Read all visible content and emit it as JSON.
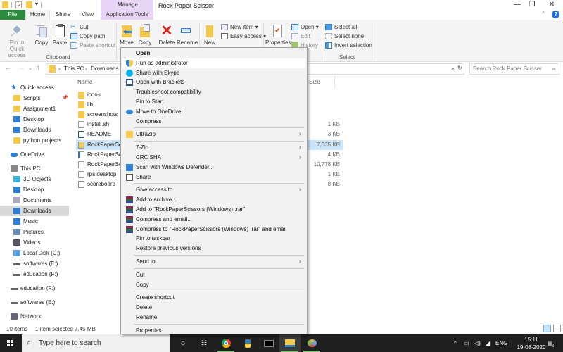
{
  "window": {
    "title": "Rock Paper Scissor",
    "contextual_tab_group": "Manage",
    "controls": {
      "minimize": "—",
      "maximize": "❐",
      "close": "✕"
    }
  },
  "tabs": [
    {
      "label": "File"
    },
    {
      "label": "Home",
      "active": true
    },
    {
      "label": "Share"
    },
    {
      "label": "View"
    },
    {
      "label": "Application Tools"
    }
  ],
  "ribbon": {
    "clipboard": {
      "label": "Clipboard",
      "pin": "Pin to Quick access",
      "pin_line1": "Pin to Quick",
      "pin_line2": "access",
      "copy": "Copy",
      "paste": "Paste",
      "cut": "Cut",
      "copy_path": "Copy path",
      "paste_shortcut": "Paste shortcut"
    },
    "organize": {
      "move": "Move",
      "copy": "Copy",
      "delete": "Delete",
      "rename": "Rename"
    },
    "new": {
      "new_folder": "New",
      "new_item": "New item ▾",
      "easy_access": "Easy access ▾"
    },
    "open": {
      "properties": "Properties",
      "open": "Open ▾",
      "edit": "Edit",
      "history": "History"
    },
    "select": {
      "label": "Select",
      "select_all": "Select all",
      "select_none": "Select none",
      "invert": "Invert selection"
    }
  },
  "address": {
    "breadcrumb": [
      "This PC",
      "Downloads"
    ],
    "separator": "›",
    "search_placeholder": "Search Rock Paper Scissor"
  },
  "navpane": {
    "items": [
      {
        "label": "Quick access",
        "icon": "star-icon",
        "level": 0
      },
      {
        "label": "Scripts",
        "icon": "folder-icon",
        "level": 1,
        "pinned": true
      },
      {
        "label": "Assignment1",
        "icon": "folder-icon",
        "level": 1
      },
      {
        "label": "Desktop",
        "icon": "desktop-icon",
        "level": 1
      },
      {
        "label": "Downloads",
        "icon": "download-icon",
        "level": 1
      },
      {
        "label": "python projects",
        "icon": "folder-icon",
        "level": 1
      },
      {
        "label": "OneDrive",
        "icon": "cloud-icon",
        "level": 0
      },
      {
        "label": "This PC",
        "icon": "pc-icon",
        "level": 0
      },
      {
        "label": "3D Objects",
        "icon": "cube-icon",
        "level": 1
      },
      {
        "label": "Desktop",
        "icon": "desktop-icon",
        "level": 1
      },
      {
        "label": "Documents",
        "icon": "document-icon",
        "level": 1
      },
      {
        "label": "Downloads",
        "icon": "download-icon",
        "level": 1,
        "selected": true
      },
      {
        "label": "Music",
        "icon": "music-icon",
        "level": 1
      },
      {
        "label": "Pictures",
        "icon": "picture-icon",
        "level": 1
      },
      {
        "label": "Videos",
        "icon": "video-icon",
        "level": 1
      },
      {
        "label": "Local Disk (C:)",
        "icon": "disk-icon",
        "level": 1
      },
      {
        "label": "softwares (E:)",
        "icon": "drive-icon",
        "level": 1
      },
      {
        "label": "education (F:)",
        "icon": "drive-icon",
        "level": 1
      },
      {
        "label": "education (F:)",
        "icon": "drive-icon",
        "level": 0
      },
      {
        "label": "softwares (E:)",
        "icon": "drive-icon",
        "level": 0
      },
      {
        "label": "Network",
        "icon": "network-icon",
        "level": 0
      }
    ]
  },
  "filelist": {
    "columns": {
      "name": "Name",
      "size": "Size"
    },
    "files": [
      {
        "name": "icons",
        "type": "folder",
        "size": ""
      },
      {
        "name": "lib",
        "type": "folder",
        "size": ""
      },
      {
        "name": "screenshots",
        "type": "folder",
        "size": ""
      },
      {
        "name": "install.sh",
        "type": "file",
        "size": "1 KB"
      },
      {
        "name": "README",
        "type": "brackets",
        "size": "3 KB"
      },
      {
        "name": "RockPaperScis",
        "type": "exe",
        "size": "7,635 KB",
        "selected": true
      },
      {
        "name": "RockPaperScis",
        "type": "python",
        "size": "4 KB"
      },
      {
        "name": "RockPaperScis",
        "type": "file",
        "size": "10,778 KB"
      },
      {
        "name": "rps.desktop",
        "type": "file",
        "size": "1 KB"
      },
      {
        "name": "scoreboard",
        "type": "text",
        "size": "8 KB"
      }
    ]
  },
  "status": {
    "count": "10 items",
    "selection": "1 item selected  7.45 MB"
  },
  "context_menu": {
    "items": [
      {
        "label": "Open",
        "bold": true
      },
      {
        "label": "Run as administrator",
        "icon": "shield-icon",
        "highlight": true
      },
      {
        "label": "Share with Skype",
        "icon": "skype-icon"
      },
      {
        "label": "Open with Brackets",
        "icon": "brackets-icon"
      },
      {
        "label": "Troubleshoot compatibility"
      },
      {
        "label": "Pin to Start"
      },
      {
        "label": "Move to OneDrive",
        "icon": "onedrive-icon"
      },
      {
        "label": "Compress"
      },
      {
        "sep": true
      },
      {
        "label": "UltraZip",
        "icon": "folder-icon",
        "submenu": true
      },
      {
        "sep": true
      },
      {
        "label": "7-Zip",
        "submenu": true
      },
      {
        "label": "CRC SHA",
        "submenu": true
      },
      {
        "label": "Scan with Windows Defender...",
        "icon": "defender-icon"
      },
      {
        "label": "Share",
        "icon": "share-icon"
      },
      {
        "sep": true
      },
      {
        "label": "Give access to",
        "submenu": true
      },
      {
        "label": "Add to archive...",
        "icon": "winrar-icon"
      },
      {
        "label": "Add to \"RockPaperScissors (Windows) .rar\"",
        "icon": "winrar-icon"
      },
      {
        "label": "Compress and email...",
        "icon": "winrar-icon"
      },
      {
        "label": "Compress to \"RockPaperScissors (Windows) .rar\" and email",
        "icon": "winrar-icon"
      },
      {
        "label": "Pin to taskbar"
      },
      {
        "label": "Restore previous versions"
      },
      {
        "sep": true
      },
      {
        "label": "Send to",
        "submenu": true
      },
      {
        "sep": true
      },
      {
        "label": "Cut"
      },
      {
        "label": "Copy"
      },
      {
        "sep": true
      },
      {
        "label": "Create shortcut"
      },
      {
        "label": "Delete"
      },
      {
        "label": "Rename"
      },
      {
        "sep": true
      },
      {
        "label": "Properties"
      }
    ]
  },
  "taskbar": {
    "search_placeholder": "Type here to search",
    "apps": [
      "cortana-icon",
      "task-view-icon",
      "chrome-icon",
      "python-icon",
      "terminal-icon",
      "file-explorer-icon",
      "paint-icon"
    ],
    "tray": {
      "language": "ENG",
      "time": "15:11",
      "date": "19-08-2020",
      "notifications": "2"
    }
  },
  "colors": {
    "file_tab": "#2b8a3e",
    "manage_tab": "#e8d5f5",
    "selection": "#cce4f7",
    "nav_selected": "#d9d9d9",
    "taskbar": "#1f1f1f",
    "folder": "#f5c94b",
    "accent_blue": "#2f7fd1"
  }
}
